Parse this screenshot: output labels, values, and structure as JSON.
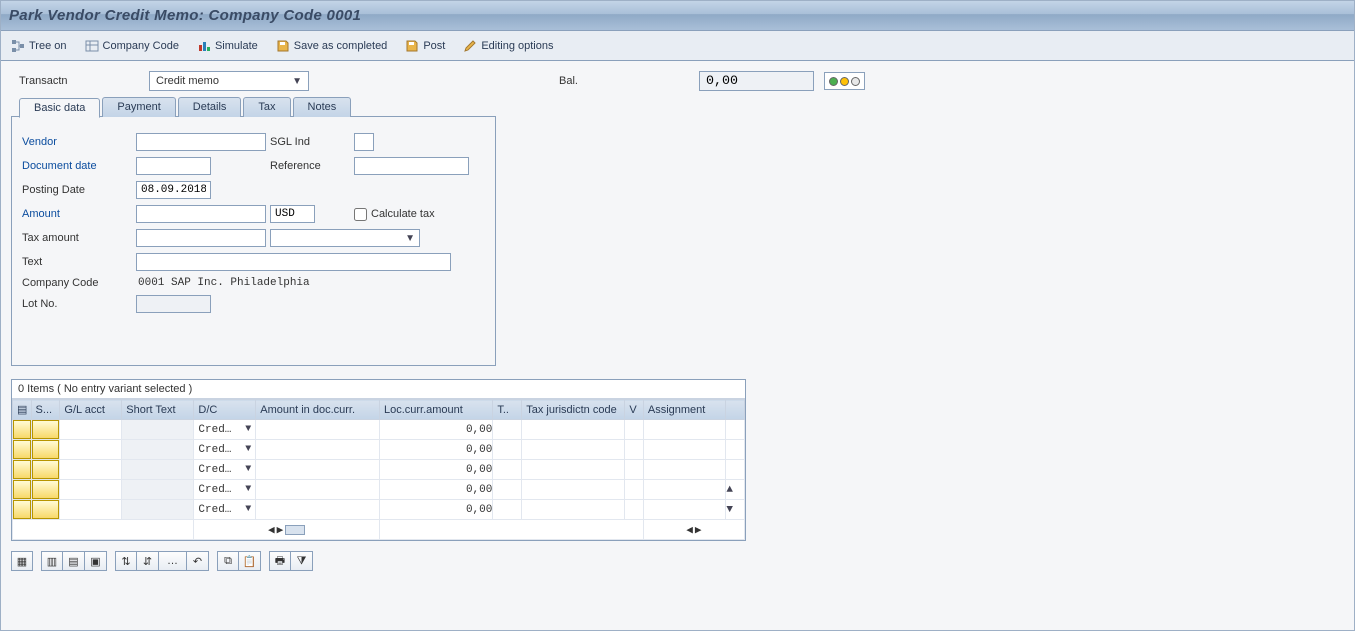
{
  "title": "Park Vendor Credit Memo: Company Code 0001",
  "toolbar": {
    "tree_on": "Tree on",
    "company_code": "Company Code",
    "simulate": "Simulate",
    "save_completed": "Save as completed",
    "post": "Post",
    "editing_options": "Editing options"
  },
  "form": {
    "transactn_label": "Transactn",
    "transactn_value": "Credit memo",
    "bal_label": "Bal.",
    "bal_value": "0,00"
  },
  "tabs": {
    "basic": "Basic data",
    "payment": "Payment",
    "details": "Details",
    "tax": "Tax",
    "notes": "Notes"
  },
  "basic_data": {
    "vendor_label": "Vendor",
    "vendor_value": "",
    "sgl_ind_label": "SGL Ind",
    "sgl_ind_value": "",
    "document_date_label": "Document date",
    "document_date_value": "",
    "reference_label": "Reference",
    "reference_value": "",
    "posting_date_label": "Posting Date",
    "posting_date_value": "08.09.2018",
    "amount_label": "Amount",
    "amount_value": "",
    "currency_value": "USD",
    "calculate_tax_label": "Calculate tax",
    "tax_amount_label": "Tax amount",
    "tax_amount_value": "",
    "tax_code_value": "",
    "text_label": "Text",
    "text_value": "",
    "company_code_label": "Company Code",
    "company_code_value": "0001 SAP Inc. Philadelphia",
    "lot_no_label": "Lot No.",
    "lot_no_value": ""
  },
  "items": {
    "title": "0 Items ( No entry variant selected )",
    "columns": {
      "sel": "",
      "status": "S...",
      "gl_acct": "G/L acct",
      "short_text": "Short Text",
      "dc": "D/C",
      "amount_doc_curr": "Amount in doc.curr.",
      "loc_curr_amount": "Loc.curr.amount",
      "tax": "T..",
      "tax_jurisdiction": "Tax jurisdictn code",
      "value_date": "V",
      "assignment": "Assignment"
    },
    "dc_value": "Cred…",
    "zero_amount": "0,00",
    "rows": [
      0,
      1,
      2,
      3,
      4
    ]
  },
  "bottom_toolbar": {
    "b1": "select-all-icon",
    "b2": "insert-row-icon",
    "b3": "delete-row-icon",
    "b4": "duplicate-row-icon",
    "b5": "sort-asc-icon",
    "b6": "sort-desc-icon",
    "b7": "more-icon",
    "b8": "undo-icon",
    "b9": "copy-icon",
    "b10": "paste-icon",
    "b11": "print-icon",
    "b12": "filter-icon"
  }
}
